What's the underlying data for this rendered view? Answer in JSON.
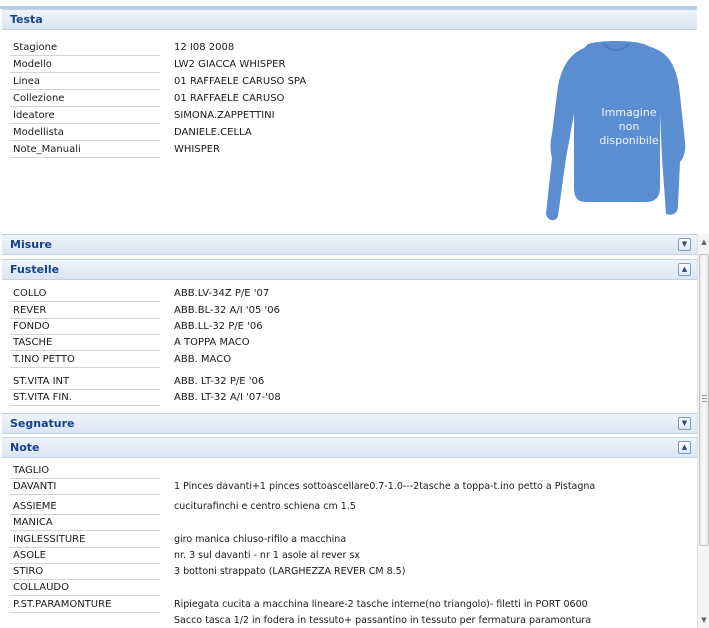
{
  "testa": {
    "title": "Testa",
    "rows": [
      {
        "label": "Stagione",
        "value": "12 I08 2008"
      },
      {
        "label": "Modello",
        "value": "LW2 GIACCA WHISPER"
      },
      {
        "label": "Linea",
        "value": "01 RAFFAELE CARUSO SPA"
      },
      {
        "label": "Collezione",
        "value": "01 RAFFAELE CARUSO"
      },
      {
        "label": "Ideatore",
        "value": "SIMONA.ZAPPETTINI"
      },
      {
        "label": "Modellista",
        "value": "DANIELE.CELLA"
      },
      {
        "label": "Note_Manuali",
        "value": "WHISPER"
      }
    ],
    "image_placeholder": {
      "line1": "Immagine",
      "line2": "non",
      "line3": "disponibile",
      "color": "#5b8ed0"
    }
  },
  "misure": {
    "title": "Misure",
    "toggle": "expand-icon"
  },
  "fustelle": {
    "title": "Fustelle",
    "toggle": "collapse-icon",
    "rows": [
      {
        "label": "COLLO",
        "value": "ABB.LV-34Z P/E '07"
      },
      {
        "label": "REVER",
        "value": "ABB.BL-32 A/I '05 '06"
      },
      {
        "label": "FONDO",
        "value": "ABB.LL-32 P/E '06"
      },
      {
        "label": "TASCHE",
        "value": "A TOPPA MACO"
      },
      {
        "label": "T.INO PETTO",
        "value": "ABB. MACO"
      },
      {
        "label": "ST.VITA INT",
        "value": "ABB. LT-32 P/E '06"
      },
      {
        "label": "ST.VITA FIN.",
        "value": "ABB. LT-32 A/I '07-'08"
      }
    ]
  },
  "segnature": {
    "title": "Segnature",
    "toggle": "expand-icon"
  },
  "note": {
    "title": "Note",
    "toggle": "collapse-icon",
    "rows": [
      {
        "label": "TAGLIO",
        "value": ""
      },
      {
        "label": "DAVANTI",
        "value": "1 Pinces davanti+1 pinces sottoascellare0.7-1.0---2tasche a toppa-t.ino petto a Pistagna"
      },
      {
        "label": "ASSIEME",
        "value": "cuciturafinchi e centro schiena cm 1.5"
      },
      {
        "label": "MANICA",
        "value": ""
      },
      {
        "label": "INGLESSITURE",
        "value": "giro manica chiuso-rifilo a macchina"
      },
      {
        "label": "ASOLE",
        "value": "nr. 3 sul davanti - nr 1 asole al rever sx"
      },
      {
        "label": "STIRO",
        "value": "3 bottoni strappato (LARGHEZZA REVER CM 8.5)"
      },
      {
        "label": "COLLAUDO",
        "value": ""
      },
      {
        "label": "P.ST.PARAMONTURE",
        "value": "Ripiegata cucita a macchina lineare-2 tasche interne(no triangolo)- filetti in PORT 0600"
      },
      {
        "label": "",
        "value": "Sacco tasca 1/2 in fodera in tessuto+ passantino in tessuto per fermatura paramontura"
      }
    ]
  },
  "scrollbar": {
    "up": "scroll-up-arrow-icon",
    "down": "scroll-down-arrow-icon"
  }
}
